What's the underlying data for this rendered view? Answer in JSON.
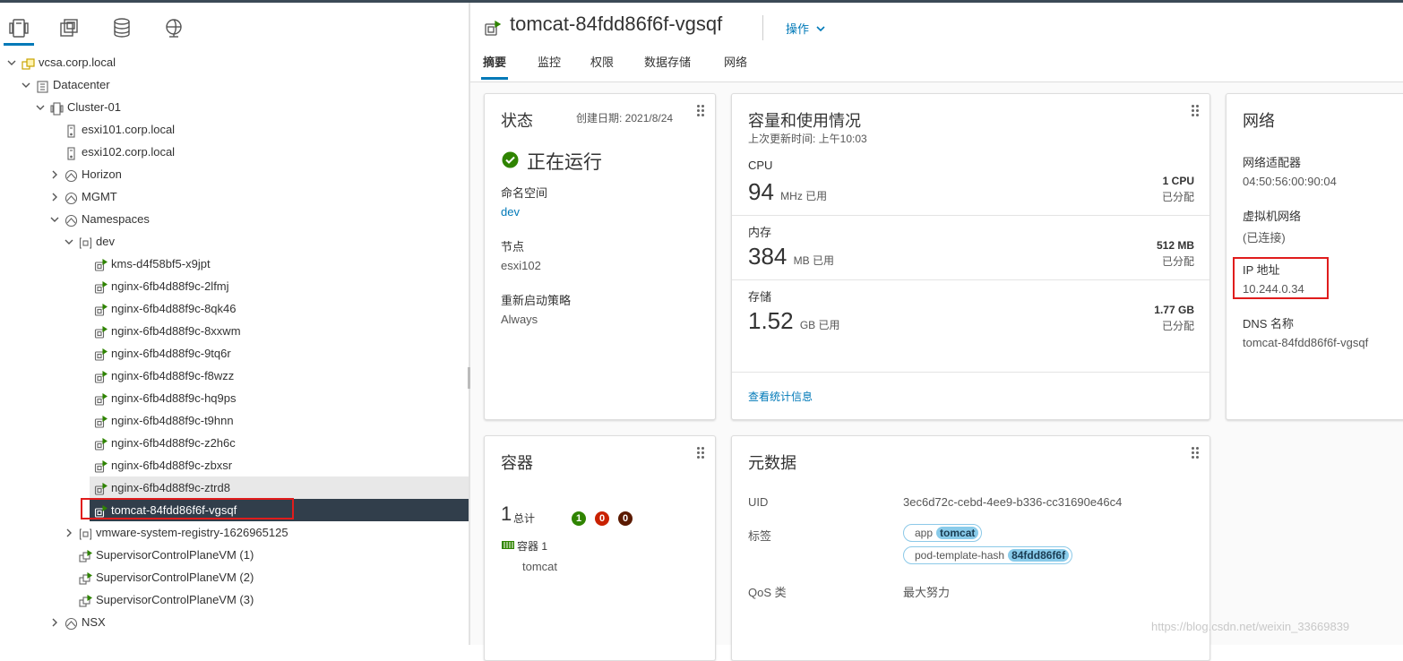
{
  "nav": {
    "tabs": [
      {
        "name": "hosts-clusters-tab",
        "icon": "hosts-clusters-icon",
        "active": true
      },
      {
        "name": "vms-templates-tab",
        "icon": "vms-templates-icon"
      },
      {
        "name": "storage-tab",
        "icon": "storage-icon"
      },
      {
        "name": "networking-tab",
        "icon": "networking-icon"
      }
    ],
    "tree": [
      {
        "label": "vcsa.corp.local",
        "level": 0,
        "chevron": "down",
        "icon": "vcenter-icon"
      },
      {
        "label": "Datacenter",
        "level": 1,
        "chevron": "down",
        "icon": "datacenter-icon"
      },
      {
        "label": "Cluster-01",
        "level": 2,
        "chevron": "down",
        "icon": "cluster-icon"
      },
      {
        "label": "esxi101.corp.local",
        "level": 3,
        "chevron": "",
        "icon": "host-icon"
      },
      {
        "label": "esxi102.corp.local",
        "level": 3,
        "chevron": "",
        "icon": "host-icon"
      },
      {
        "label": "Horizon",
        "level": 3,
        "chevron": "right",
        "icon": "resource-pool-icon"
      },
      {
        "label": "MGMT",
        "level": 3,
        "chevron": "right",
        "icon": "resource-pool-icon"
      },
      {
        "label": "Namespaces",
        "level": 3,
        "chevron": "down",
        "icon": "resource-pool-icon"
      },
      {
        "label": "dev",
        "level": 4,
        "chevron": "down",
        "icon": "namespace-icon"
      },
      {
        "label": "kms-d4f58bf5-x9jpt",
        "level": 5,
        "chevron": "",
        "icon": "pod-icon"
      },
      {
        "label": "nginx-6fb4d88f9c-2lfmj",
        "level": 5,
        "chevron": "",
        "icon": "pod-icon"
      },
      {
        "label": "nginx-6fb4d88f9c-8qk46",
        "level": 5,
        "chevron": "",
        "icon": "pod-icon"
      },
      {
        "label": "nginx-6fb4d88f9c-8xxwm",
        "level": 5,
        "chevron": "",
        "icon": "pod-icon"
      },
      {
        "label": "nginx-6fb4d88f9c-9tq6r",
        "level": 5,
        "chevron": "",
        "icon": "pod-icon"
      },
      {
        "label": "nginx-6fb4d88f9c-f8wzz",
        "level": 5,
        "chevron": "",
        "icon": "pod-icon"
      },
      {
        "label": "nginx-6fb4d88f9c-hq9ps",
        "level": 5,
        "chevron": "",
        "icon": "pod-icon"
      },
      {
        "label": "nginx-6fb4d88f9c-t9hnn",
        "level": 5,
        "chevron": "",
        "icon": "pod-icon"
      },
      {
        "label": "nginx-6fb4d88f9c-z2h6c",
        "level": 5,
        "chevron": "",
        "icon": "pod-icon"
      },
      {
        "label": "nginx-6fb4d88f9c-zbxsr",
        "level": 5,
        "chevron": "",
        "icon": "pod-icon"
      },
      {
        "label": "nginx-6fb4d88f9c-ztrd8",
        "level": 5,
        "chevron": "",
        "icon": "pod-icon",
        "state": "hover"
      },
      {
        "label": "tomcat-84fdd86f6f-vgsqf",
        "level": 5,
        "chevron": "",
        "icon": "pod-icon",
        "state": "selected"
      },
      {
        "label": "vmware-system-registry-1626965125",
        "level": 4,
        "chevron": "right",
        "icon": "namespace-icon"
      },
      {
        "label": "SupervisorControlPlaneVM (1)",
        "level": 4,
        "chevron": "",
        "icon": "vm-icon"
      },
      {
        "label": "SupervisorControlPlaneVM (2)",
        "level": 4,
        "chevron": "",
        "icon": "vm-icon"
      },
      {
        "label": "SupervisorControlPlaneVM (3)",
        "level": 4,
        "chevron": "",
        "icon": "vm-icon"
      },
      {
        "label": "NSX",
        "level": 3,
        "chevron": "right",
        "icon": "resource-pool-icon"
      }
    ]
  },
  "header": {
    "title": "tomcat-84fdd86f6f-vgsqf",
    "actions_label": "操作",
    "tabs": [
      "摘要",
      "监控",
      "权限",
      "数据存储",
      "网络"
    ]
  },
  "status_card": {
    "title": "状态",
    "created": "创建日期: 2021/8/24",
    "state": "正在运行",
    "namespace_label": "命名空间",
    "namespace_value": "dev",
    "node_label": "节点",
    "node_value": "esxi102",
    "restart_label": "重新启动策略",
    "restart_value": "Always"
  },
  "capacity_card": {
    "title": "容量和使用情况",
    "updated": "上次更新时间: 上午10:03",
    "cpu": {
      "label": "CPU",
      "value": "94",
      "unit": "MHz 已用",
      "alloc": "1 CPU",
      "alloc_label": "已分配"
    },
    "mem": {
      "label": "内存",
      "value": "384",
      "unit": "MB 已用",
      "alloc": "512 MB",
      "alloc_label": "已分配"
    },
    "storage": {
      "label": "存储",
      "value": "1.52",
      "unit": "GB 已用",
      "alloc": "1.77 GB",
      "alloc_label": "已分配"
    },
    "stats_link": "查看统计信息"
  },
  "network_card": {
    "title": "网络",
    "adapter_label": "网络适配器",
    "adapter_value": "04:50:56:00:90:04",
    "vmnet_label": "虚拟机网络",
    "vmnet_value": "(已连接)",
    "ip_label": "IP 地址",
    "ip_value": "10.244.0.34",
    "dns_label": "DNS 名称",
    "dns_value": "tomcat-84fdd86f6f-vgsqf"
  },
  "containers_card": {
    "title": "容器",
    "total_value": "1",
    "total_label": "总计",
    "badges": [
      {
        "value": "1",
        "color": "#2f8400"
      },
      {
        "value": "0",
        "color": "#c92100"
      },
      {
        "value": "0",
        "color": "#5b1a00"
      }
    ],
    "container_label": "容器 1",
    "container_name": "tomcat"
  },
  "metadata_card": {
    "title": "元数据",
    "uid_label": "UID",
    "uid_value": "3ec6d72c-cebd-4ee9-b336-cc31690e46c4",
    "labels_label": "标签",
    "tags": [
      {
        "key": "app",
        "value": "tomcat"
      },
      {
        "key": "pod-template-hash",
        "value": "84fdd86f6f"
      }
    ],
    "qos_label": "QoS 类",
    "qos_value": "最大努力"
  },
  "watermark": "https://blog.csdn.net/weixin_33669839"
}
